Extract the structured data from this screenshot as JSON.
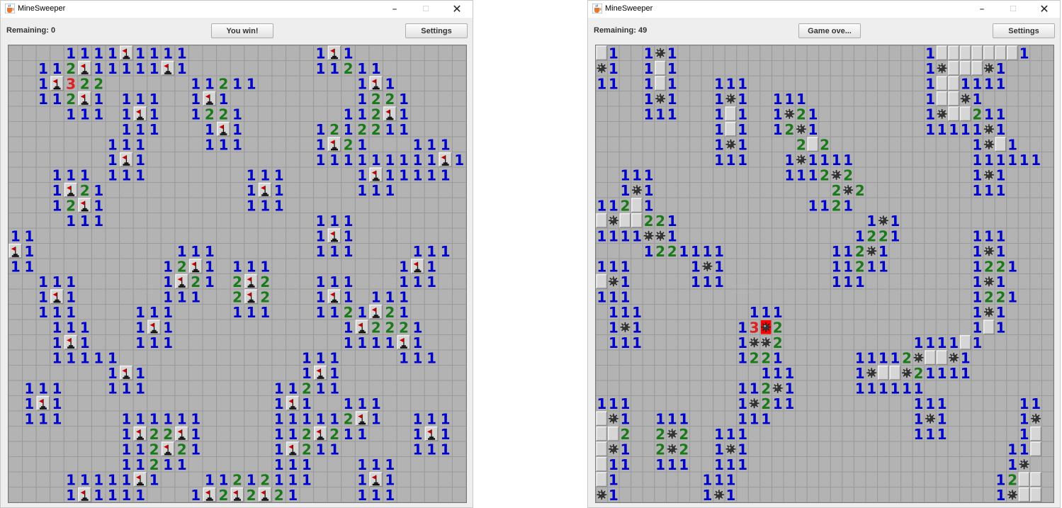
{
  "windows": [
    {
      "title": "MineSweeper",
      "remaining_label": "Remaining: 0",
      "status_button": "You win!",
      "settings_button": "Settings",
      "grid_rows": [
        "....1111F1111.........1F1........",
        "..112F11111F1.........11211......",
        "..1F322......11211.......1F1.....",
        "..112F1.111..1F1.........1221....",
        "....111.1F1..1221.......112F1....",
        "........111...1F1.....1212211....",
        ".......111....111.....1F21...111.",
        ".......1F1............111111111F1",
        "...111.111.......111.....1F11111.",
        "...1F21..........1F1.....111.....",
        "...12F1..........111.............",
        "....111...............111........",
        "11....................1F1........",
        "F1..........111.......111....111.",
        "11.........12F1.111.........1F1..",
        "..111......1F21.2F2...111...111..",
        "..1F1......111..2F2...1F1.111....",
        "..111....111....111...1121F21....",
        "...111...1F1............1F2221...",
        "...1F1...111............1111F1...",
        "...11111.............111....111..",
        ".......1F1...........1F1.........",
        ".111...111.........11211.........",
        ".1F1...............1F1..111......",
        ".111....111111.....111112F1..111.",
        "........1F22F1.....112F211...1F1.",
        "........112F21.....1F211.....111.",
        "........11211......111...111.....",
        "....11111F1...11212111...1F1.....",
        "....1F1111...1F2F2F21....111....."
      ]
    },
    {
      "title": "MineSweeper",
      "remaining_label": "Remaining: 49",
      "status_button": "Game ove...",
      "settings_button": "Settings",
      "grid_rows": [
        "#1..1M1.....................1#######1..",
        "M1..1#1.....................1M###M1....",
        "11..1#1...111...............1##1111....",
        "....1M1...1M1..111..........1##M1......",
        "....111...1#1..1M21.........1M##211....",
        "..........1#1..12M1.........11111M1....",
        "..........1M1....2#2............1M#1...",
        "..........111...1M1111..........111111.",
        "..111...........1112M2..........1M1....",
        "..1M1...............2M2.........111....",
        "112#1.............1121.................",
        "#M##221................1M1.............",
        "1111MM1...............1221......111....",
        "....1221111.........112M1.......1M1....",
        "111.....1M1.........11211.......1221...",
        "#M1.....111.........111.........1M1....",
        "111.............................1221...",
        ".111.........111................1M1....",
        ".1M1........13X2................1#1....",
        ".111........1MM2...........1111#1......",
        "............1221......11112M##M1.......",
        "..............111.....1M##M21111.......",
        "............112M1.....111111...........",
        "111.........1M211..........111......11.",
        "#M1..111....111............1M1......1M.",
        "##2..2M2..111..............111......1#.",
        "#M1..2M2..1M1......................11#.",
        "#11..111..111......................1M..",
        "#1.......111......................12##.",
        "M1.......1M1......................1M##."
      ]
    }
  ],
  "icons": {
    "app": "java-coffee-cup-icon",
    "minimize": "minimize-icon",
    "maximize": "maximize-icon",
    "close": "close-icon",
    "flag": "flag-icon",
    "mine": "mine-icon",
    "exploded_mine": "exploded-mine-icon",
    "hidden": "hidden-cell"
  },
  "colors": {
    "number_1": "#0000cc",
    "number_2": "#1a7a1a",
    "number_3": "#e02020",
    "flag": "#cc0000",
    "exploded_bg": "#ff0000",
    "board_bg": "#b3b3b3",
    "grid_line": "#9a9a9a",
    "raised_cell": "#d6d6d6"
  }
}
